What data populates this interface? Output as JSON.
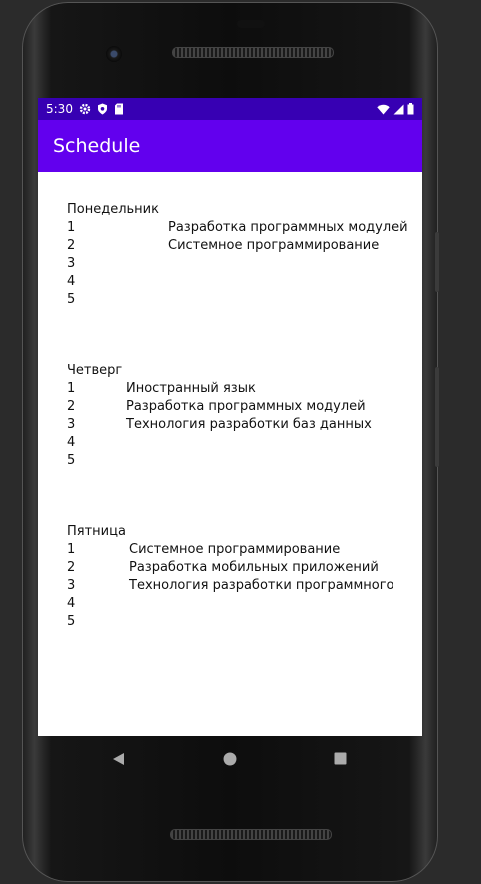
{
  "status_bar": {
    "time": "5:30"
  },
  "app_bar": {
    "title": "Schedule"
  },
  "days": [
    {
      "name": "Понедельник",
      "lessons": [
        {
          "num": "1",
          "subject": "Разработка программных модулей"
        },
        {
          "num": "2",
          "subject": "Системное программирование"
        },
        {
          "num": "3",
          "subject": ""
        },
        {
          "num": "4",
          "subject": ""
        },
        {
          "num": "5",
          "subject": ""
        }
      ]
    },
    {
      "name": "Четверг",
      "lessons": [
        {
          "num": "1",
          "subject": "Иностранный язык"
        },
        {
          "num": "2",
          "subject": "Разработка программных модулей"
        },
        {
          "num": "3",
          "subject": "Технология разработки баз данных"
        },
        {
          "num": "4",
          "subject": ""
        },
        {
          "num": "5",
          "subject": ""
        }
      ]
    },
    {
      "name": "Пятница",
      "lessons": [
        {
          "num": "1",
          "subject": "Системное программирование"
        },
        {
          "num": "2",
          "subject": "Разработка мобильных приложений"
        },
        {
          "num": "3",
          "subject": "Технология разработки программного обе"
        },
        {
          "num": "4",
          "subject": ""
        },
        {
          "num": "5",
          "subject": ""
        }
      ]
    }
  ],
  "colors": {
    "status_bar": "#3700b3",
    "app_bar": "#6200ee"
  },
  "icons": [
    "settings-icon",
    "shield-icon",
    "sd-card-icon",
    "wifi-icon",
    "signal-icon",
    "battery-icon",
    "back-icon",
    "home-icon",
    "recents-icon"
  ]
}
